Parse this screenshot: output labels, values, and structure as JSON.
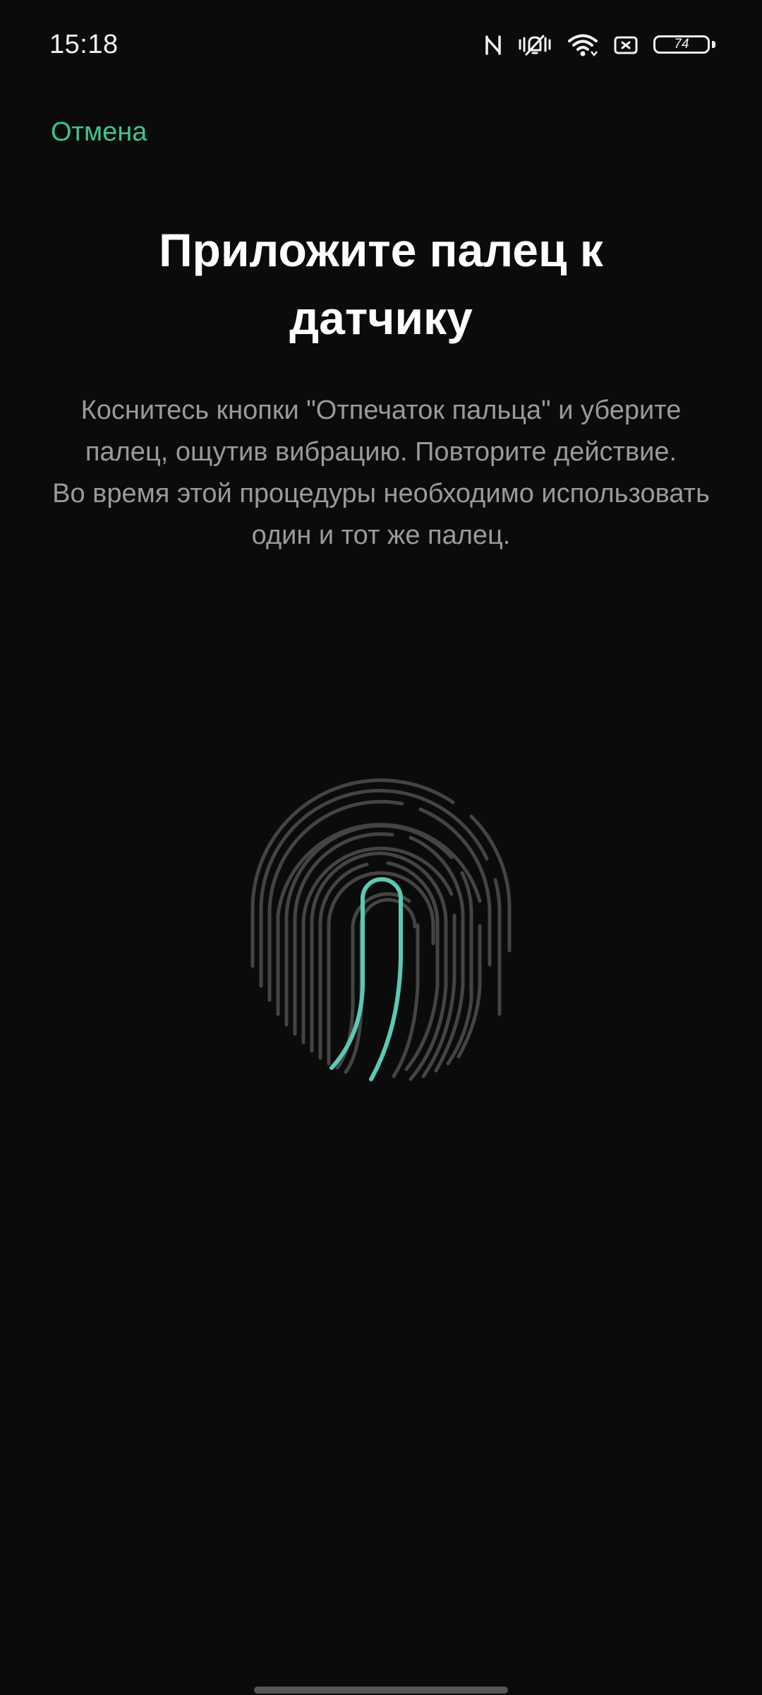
{
  "status_bar": {
    "time": "15:18",
    "icons": [
      "nfc-icon",
      "vibrate-silent-icon",
      "wifi-icon",
      "screen-cast-icon",
      "battery-icon"
    ],
    "battery_level": "74"
  },
  "header": {
    "cancel_label": "Отмена"
  },
  "main": {
    "title": "Приложите палец к датчику",
    "instruction_line1": "Коснитесь кнопки \"Отпечаток пальца\" и уберите палец, ощутив вибрацию. Повторите действие.",
    "instruction_line2": "Во время этой процедуры необходимо использовать один и тот же палец."
  },
  "fingerprint": {
    "icon": "fingerprint-icon",
    "base_color": "#444444",
    "highlight_color": "#5bc9b4"
  },
  "colors": {
    "background": "#0b0b0b",
    "accent": "#3ec58a",
    "secondary_text": "#9a9a9a"
  }
}
